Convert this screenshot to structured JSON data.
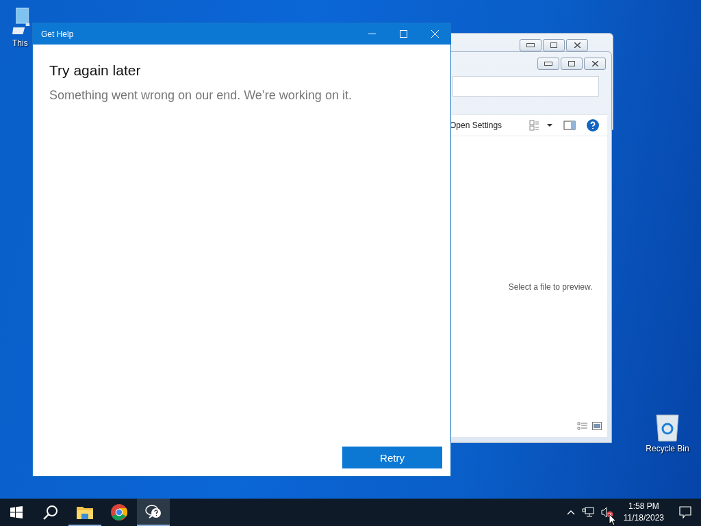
{
  "desktop_icons": [
    {
      "kind": "computer",
      "label": "This"
    },
    {
      "kind": "recycle",
      "label": "Recycle Bin"
    }
  ],
  "explorer": {
    "toolbar": {
      "open_settings": "Open Settings"
    },
    "preview_message": "Select a file to preview."
  },
  "get_help": {
    "title": "Get Help",
    "heading": "Try again later",
    "message": "Something went wrong on our end. We’re working on it.",
    "retry_button": "Retry"
  },
  "taskbar": {
    "apps": [
      {
        "kind": "explorer",
        "running": true,
        "selected": false
      },
      {
        "kind": "chrome",
        "running": false,
        "selected": false
      },
      {
        "kind": "help",
        "running": true,
        "selected": true
      }
    ],
    "volume_muted": true,
    "time": "1:58 PM",
    "date": "11/18/2023"
  }
}
